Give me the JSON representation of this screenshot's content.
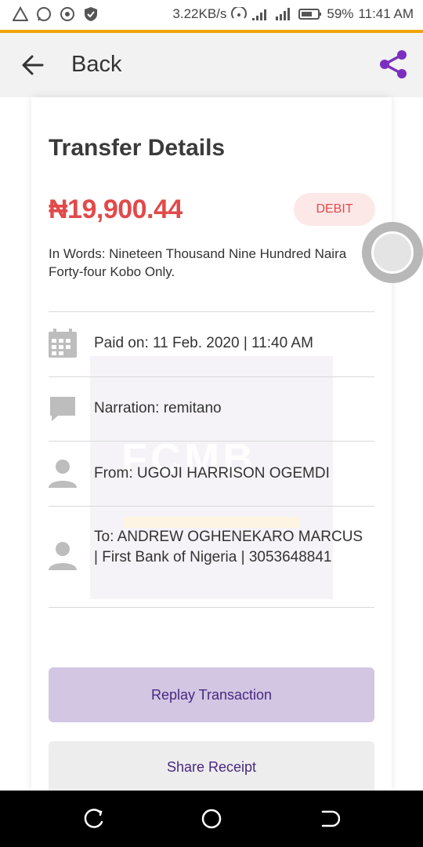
{
  "status_bar": {
    "network_speed": "3.22KB/s",
    "battery": "59%",
    "time": "11:41 AM",
    "icons": [
      "alert-icon",
      "whatsapp-icon",
      "record-icon",
      "shield-icon",
      "hotspot-icon",
      "signal-icon",
      "signal-4g-icon",
      "battery-icon"
    ]
  },
  "app_bar": {
    "back_label": "Back",
    "share_icon": "share-icon",
    "accent_color": "#7b2fbf"
  },
  "details": {
    "title": "Transfer Details",
    "amount": "₦19,900.44",
    "type_badge": "DEBIT",
    "in_words": "In Words: Nineteen Thousand Nine Hundred Naira Forty-four  Kobo Only.",
    "rows": [
      {
        "icon": "calendar-icon",
        "text": "Paid on: 11 Feb. 2020 | 11:40 AM"
      },
      {
        "icon": "comment-icon",
        "text": "Narration: remitano"
      },
      {
        "icon": "person-icon",
        "text": "From: UGOJI HARRISON OGEMDI"
      },
      {
        "icon": "person-icon",
        "text": "To: ANDREW OGHENEKARO MARCUS | First Bank of Nigeria | 3053648841"
      }
    ],
    "watermark_text": "FCMB"
  },
  "actions": {
    "replay_label": "Replay Transaction",
    "share_label": "Share Receipt"
  },
  "colors": {
    "debit_red": "#e14a4a",
    "button_purple": "#d2c6e3",
    "status_accent": "#f0a500"
  }
}
